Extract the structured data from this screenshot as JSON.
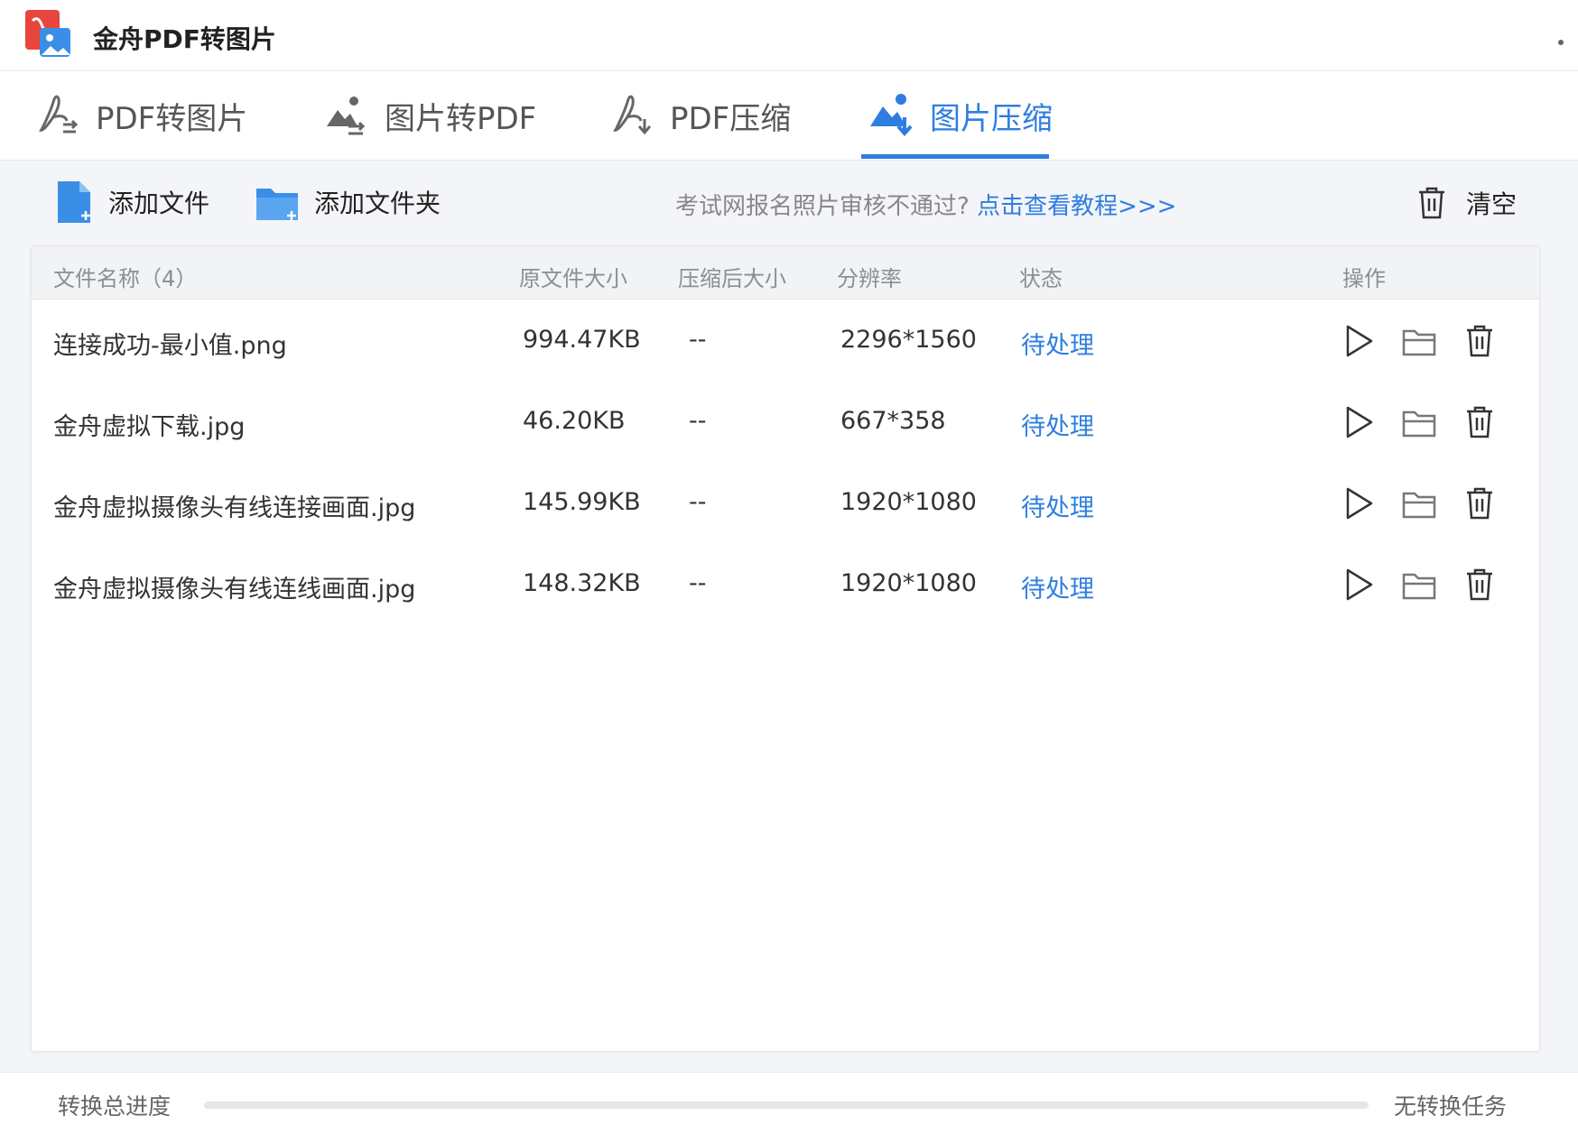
{
  "app": {
    "title": "金舟PDF转图片"
  },
  "tabs": [
    {
      "label": "PDF转图片",
      "icon": "pdf-to-image-icon",
      "active": false
    },
    {
      "label": "图片转PDF",
      "icon": "image-to-pdf-icon",
      "active": false
    },
    {
      "label": "PDF压缩",
      "icon": "pdf-compress-icon",
      "active": false
    },
    {
      "label": "图片压缩",
      "icon": "image-compress-icon",
      "active": true
    }
  ],
  "toolbar": {
    "add_file": "添加文件",
    "add_folder": "添加文件夹",
    "notice_text": "考试网报名照片审核不通过?",
    "notice_link": "点击查看教程>>>",
    "clear": "清空"
  },
  "table": {
    "headers": {
      "name": "文件名称（4）",
      "orig_size": "原文件大小",
      "comp_size": "压缩后大小",
      "resolution": "分辨率",
      "status": "状态",
      "actions": "操作"
    },
    "rows": [
      {
        "name": "连接成功-最小值.png",
        "orig_size": "994.47KB",
        "comp_size": "--",
        "resolution": "2296*1560",
        "status": "待处理"
      },
      {
        "name": "金舟虚拟下载.jpg",
        "orig_size": "46.20KB",
        "comp_size": "--",
        "resolution": "667*358",
        "status": "待处理"
      },
      {
        "name": "金舟虚拟摄像头有线连接画面.jpg",
        "orig_size": "145.99KB",
        "comp_size": "--",
        "resolution": "1920*1080",
        "status": "待处理"
      },
      {
        "name": "金舟虚拟摄像头有线连线画面.jpg",
        "orig_size": "148.32KB",
        "comp_size": "--",
        "resolution": "1920*1080",
        "status": "待处理"
      }
    ]
  },
  "footer": {
    "progress_label": "转换总进度",
    "progress_value": 0,
    "status_text": "无转换任务"
  },
  "colors": {
    "accent": "#2f7de1",
    "background": "#f3f5f8"
  }
}
